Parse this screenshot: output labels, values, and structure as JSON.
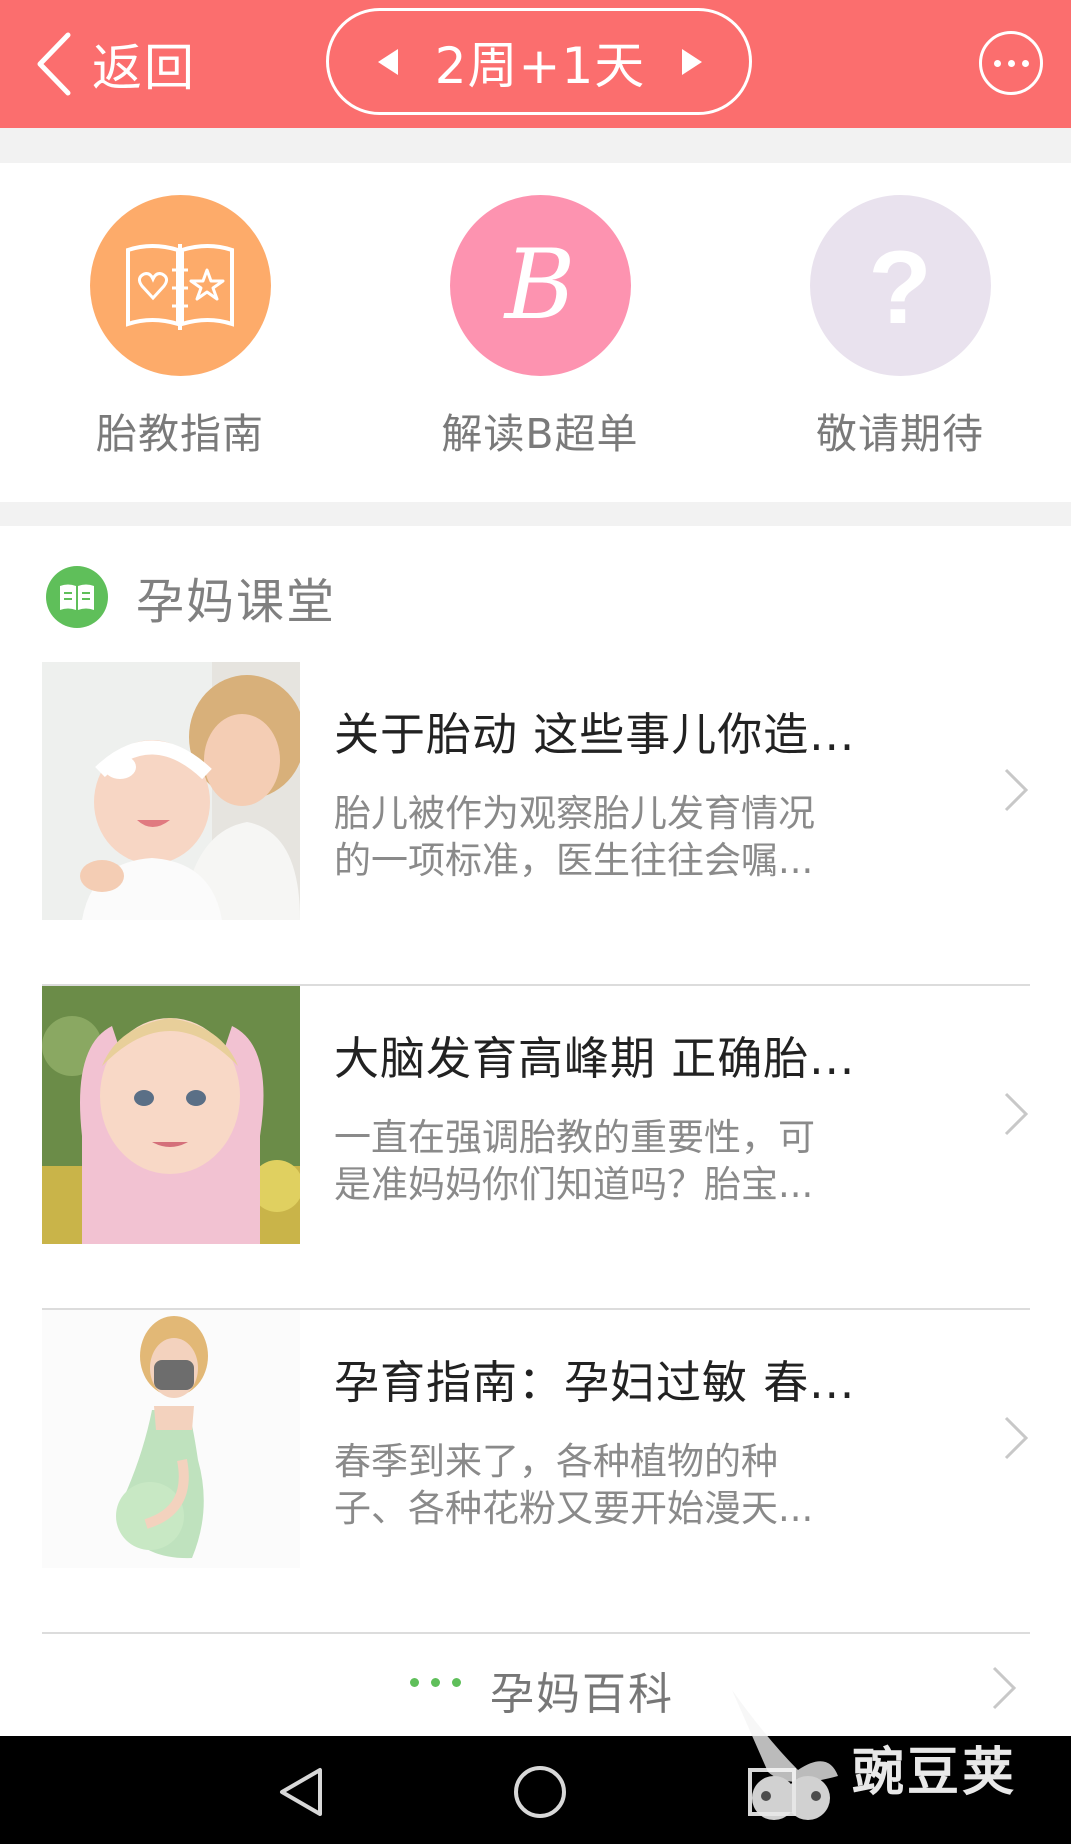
{
  "topbar": {
    "back_label": "返回",
    "week_value": "2周+1天",
    "colors": {
      "background": "#fb6e6e",
      "foreground": "#ffffff"
    },
    "icons": {
      "back": "chevron-left-icon",
      "prev": "triangle-left-icon",
      "next": "triangle-right-icon",
      "more": "more-dots-icon"
    }
  },
  "tiles": [
    {
      "label": "胎教指南",
      "icon": "book-heart-star-icon",
      "color": "#fdab6a"
    },
    {
      "label": "解读B超单",
      "icon": "letter-b-icon",
      "color": "#fd93b0"
    },
    {
      "label": "敬请期待",
      "icon": "question-mark-icon",
      "color": "#e9e2ee"
    }
  ],
  "section": {
    "title": "孕妈课堂",
    "icon": "book-icon",
    "accent": "#5fbf5a",
    "articles": [
      {
        "title": "关于胎动 这些事儿你造...",
        "summary_line1": "胎儿被作为观察胎儿发育情况",
        "summary_line2": "的一项标准，医生往往会嘱...",
        "thumb": "mother-and-baby-photo"
      },
      {
        "title": "大脑发育高峰期 正确胎...",
        "summary_line1": "一直在强调胎教的重要性，可",
        "summary_line2": "是准妈妈你们知道吗？胎宝...",
        "thumb": "toddler-photo"
      },
      {
        "title": "孕育指南：孕妇过敏 春...",
        "summary_line1": "春季到来了，各种植物的种",
        "summary_line2": "子、各种花粉又要开始漫天...",
        "thumb": "pregnant-woman-mask-photo"
      }
    ],
    "more_label": "孕妈百科"
  },
  "navbar": {
    "icons": [
      "nav-back-icon",
      "nav-home-icon",
      "nav-recent-icon"
    ]
  },
  "watermark": {
    "text": "豌豆荚"
  }
}
